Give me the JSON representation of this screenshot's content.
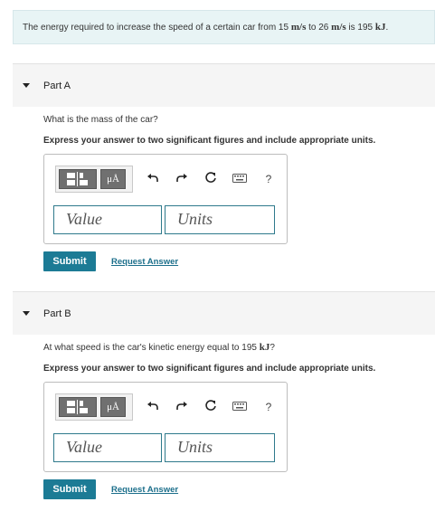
{
  "problem": {
    "text_before": "The energy required to increase the speed of a certain car from 15 ",
    "unit_ms": "m/s",
    "text_mid": " to 26 ",
    "unit_ms_2": "m/s",
    "text_mid2": " is 195 ",
    "unit_kj": "kJ",
    "text_end": "."
  },
  "parts": [
    {
      "title": "Part A",
      "question_before": "What is the mass of the car?",
      "question_unit": "",
      "question_after": "",
      "instruction": "Express your answer to two significant figures and include appropriate units.",
      "units_button": "μÅ",
      "help_icon_label": "?",
      "value_placeholder": "Value",
      "units_placeholder": "Units",
      "submit_label": "Submit",
      "request_label": "Request Answer"
    },
    {
      "title": "Part B",
      "question_before": "At what speed is the car's kinetic energy equal to 195 ",
      "question_unit": "kJ",
      "question_after": "?",
      "instruction": "Express your answer to two significant figures and include appropriate units.",
      "units_button": "μÅ",
      "help_icon_label": "?",
      "value_placeholder": "Value",
      "units_placeholder": "Units",
      "submit_label": "Submit",
      "request_label": "Request Answer"
    }
  ],
  "colors": {
    "accent": "#1c7b95",
    "problem_bg": "#e8f4f5",
    "field_border": "#2f7a8c"
  }
}
